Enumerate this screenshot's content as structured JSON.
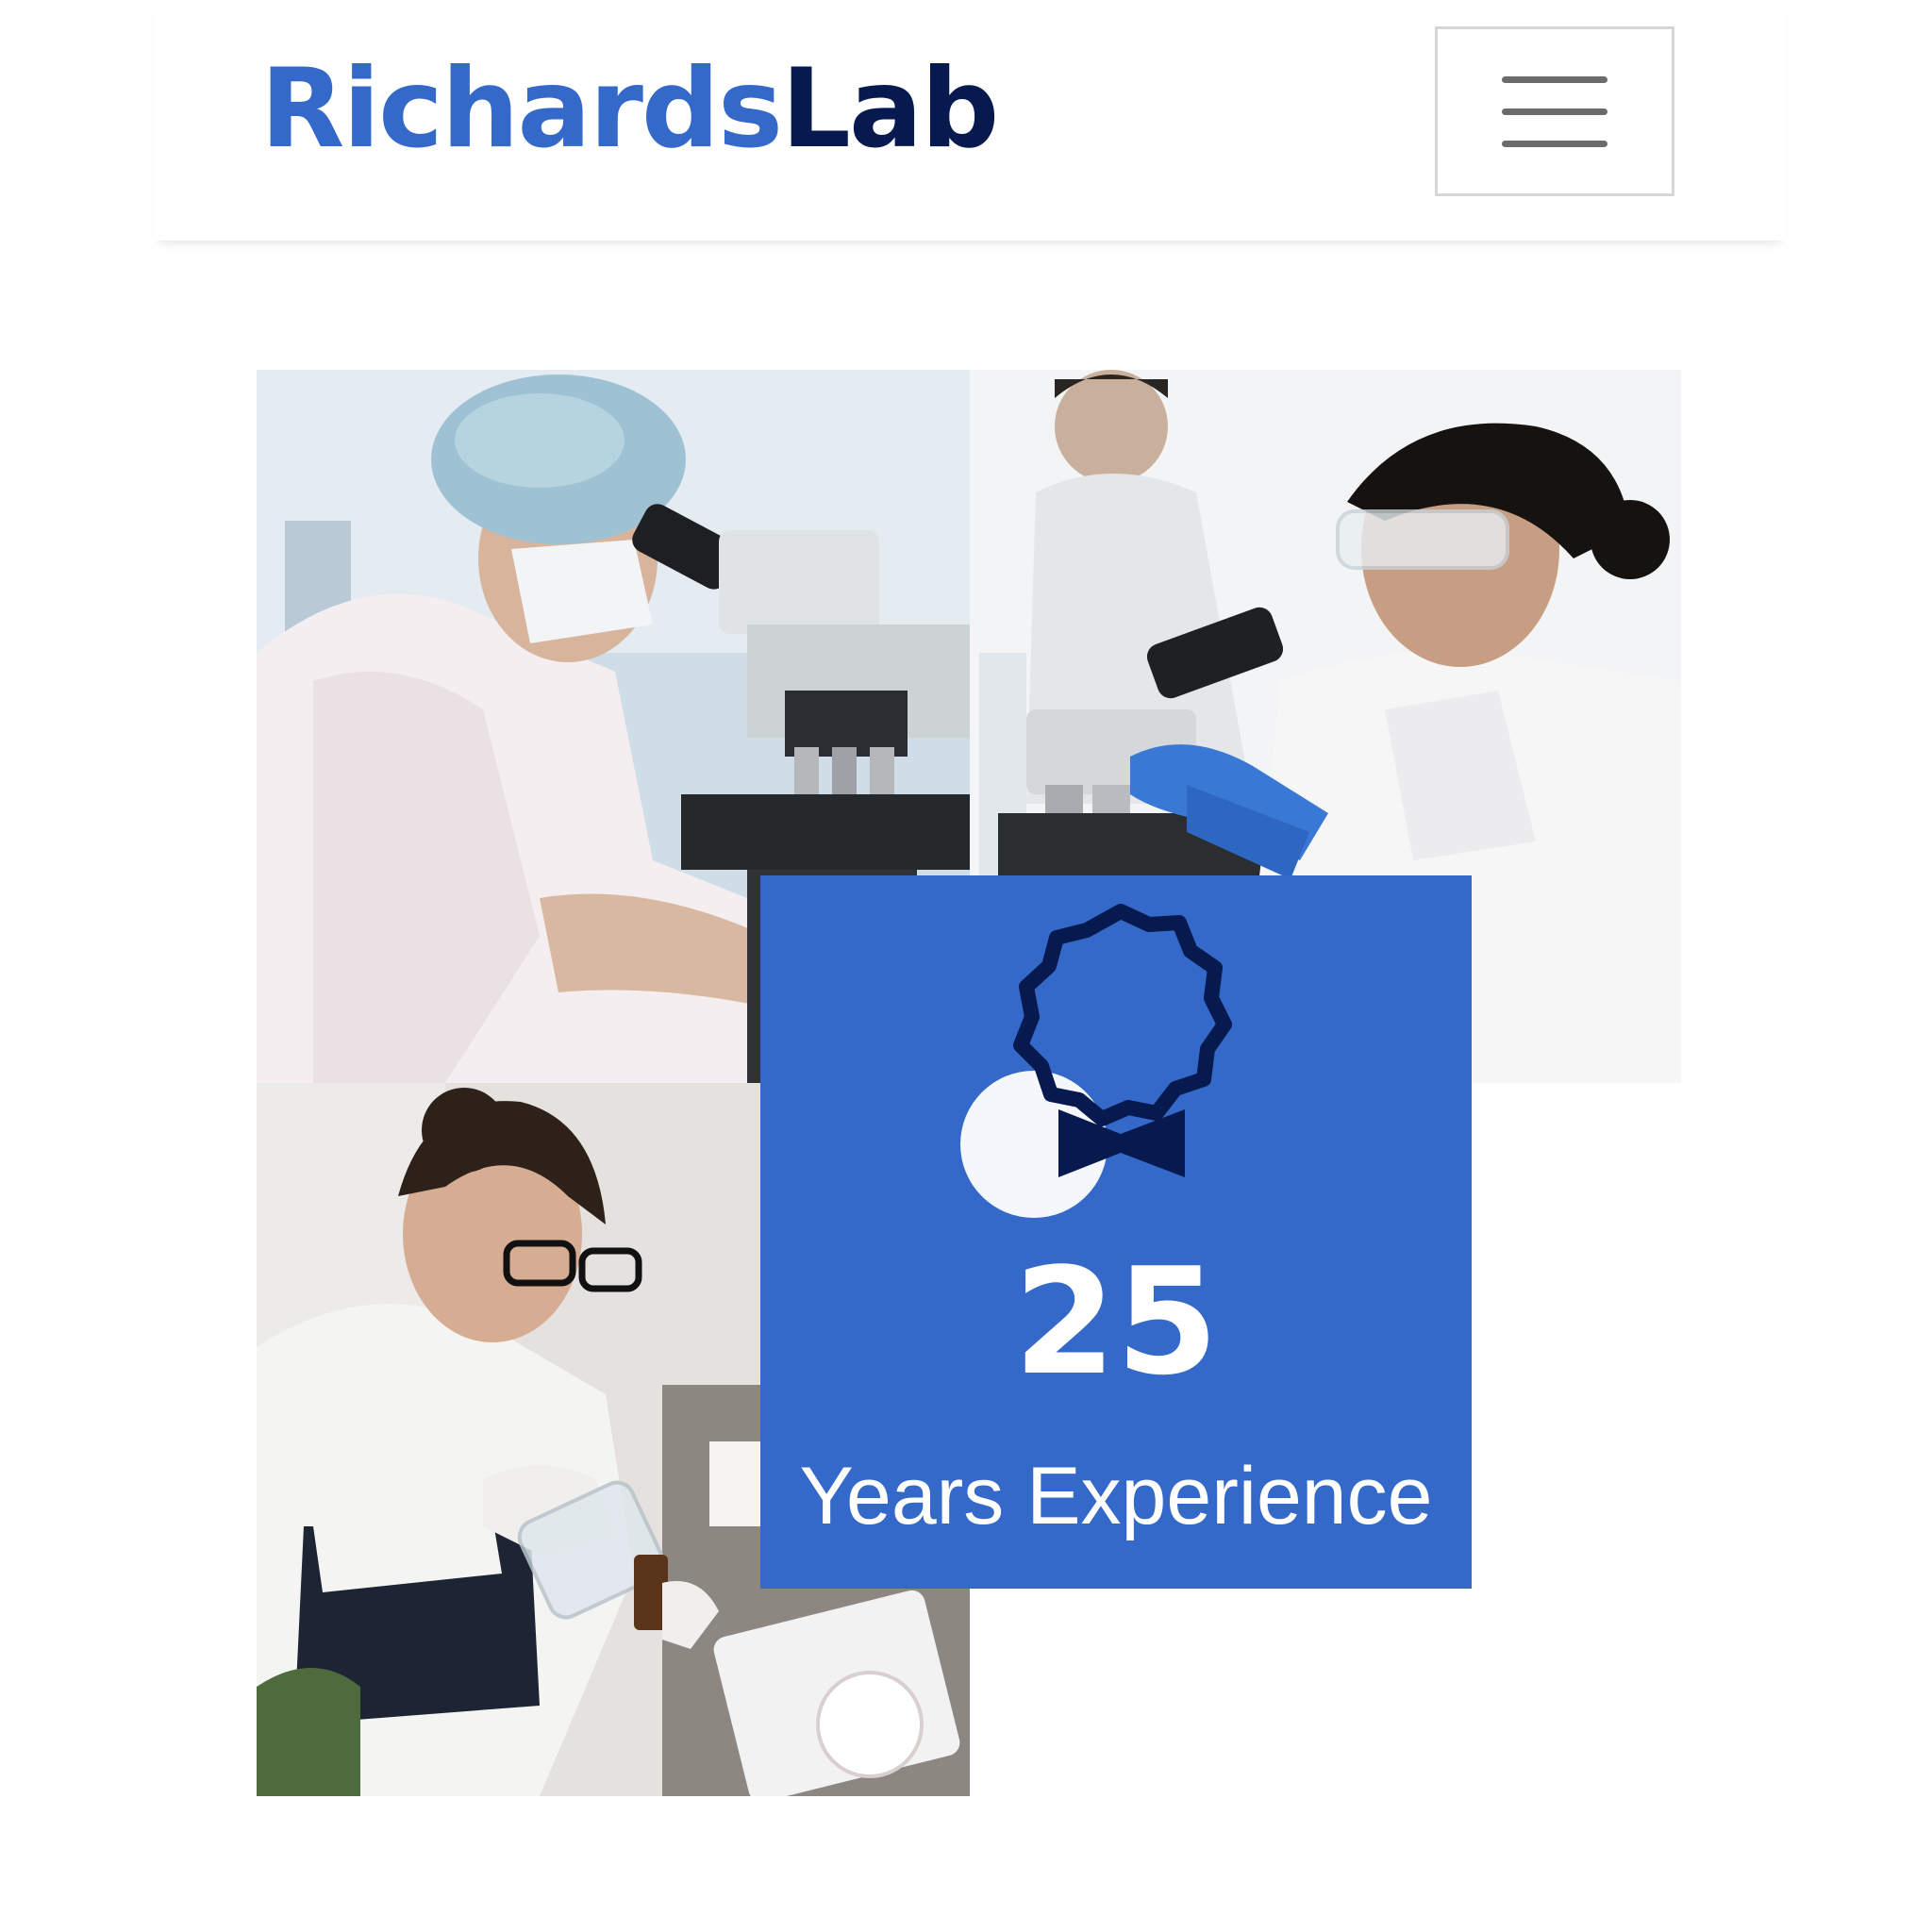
{
  "header": {
    "logo_part_a": "Richards",
    "logo_part_b": "Lab",
    "menu_icon": "hamburger-icon"
  },
  "gallery": {
    "photos": [
      {
        "name": "scientist-microscope-photo"
      },
      {
        "name": "scientist-microscope-goggles-photo"
      },
      {
        "name": "scientist-pouring-beaker-photo"
      }
    ]
  },
  "badge": {
    "icon": "award-ribbon-icon",
    "number": "25",
    "label": "Years Experience"
  },
  "colors": {
    "brand_blue": "#3469c9",
    "brand_navy": "#061a4f",
    "white": "#ffffff"
  }
}
